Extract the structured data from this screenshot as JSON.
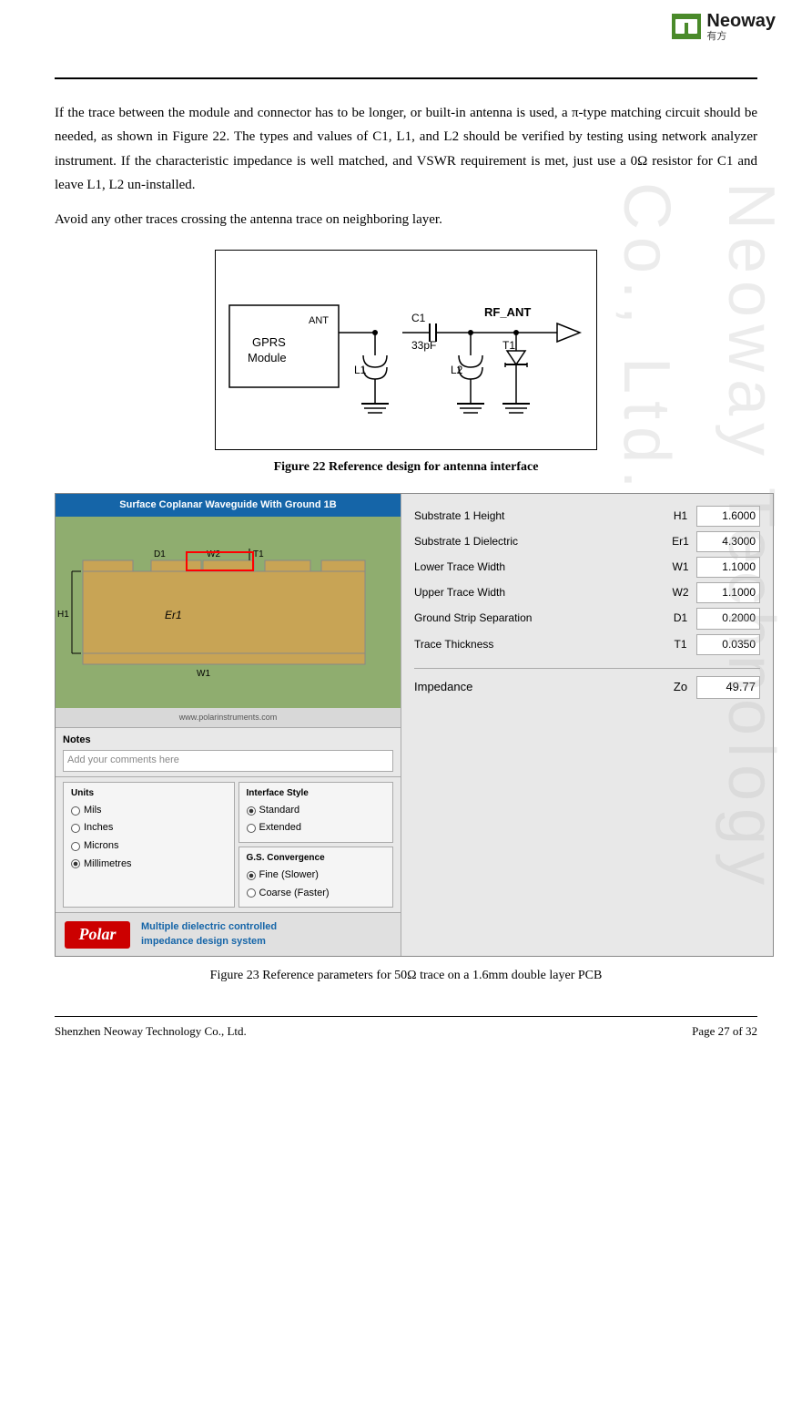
{
  "header": {
    "logo_alt": "Neoway Logo",
    "company_name": "Neoway",
    "chinese_name": "有方"
  },
  "body": {
    "paragraph1": "If the trace between the module and connector has to be longer, or built-in antenna is used, a π-type matching circuit should be needed, as shown in Figure 22. The types and values of C1, L1, and L2 should be verified by testing using network analyzer instrument. If the characteristic impedance is well matched, and VSWR requirement is met, just use a 0Ω resistor for C1 and leave L1, L2 un-installed.",
    "paragraph2": "Avoid any other traces crossing the antenna trace on neighboring layer."
  },
  "figure22": {
    "caption": "Figure 22 Reference design for antenna interface",
    "labels": {
      "ant": "ANT",
      "gprs": "GPRS",
      "module": "Module",
      "c1": "C1",
      "cap": "33pF",
      "l1": "L1",
      "l2": "L2",
      "t1": "T1",
      "rf_ant": "RF_ANT"
    }
  },
  "polar_screenshot": {
    "diagram_title": "Surface Coplanar Waveguide With Ground 1B",
    "url": "www.polarinstruments.com",
    "labels": {
      "w2": "W2",
      "d1": "D1",
      "t1": "T1",
      "h1": "H1",
      "er1": "Er1",
      "w1": "W1"
    },
    "params": [
      {
        "label": "Substrate 1 Height",
        "symbol": "H1",
        "value": "1.6000"
      },
      {
        "label": "Substrate 1 Dielectric",
        "symbol": "Er1",
        "value": "4.3000"
      },
      {
        "label": "Lower Trace Width",
        "symbol": "W1",
        "value": "1.1000"
      },
      {
        "label": "Upper Trace Width",
        "symbol": "W2",
        "value": "1.1000"
      },
      {
        "label": "Ground Strip Separation",
        "symbol": "D1",
        "value": "0.2000"
      },
      {
        "label": "Trace Thickness",
        "symbol": "T1",
        "value": "0.0350"
      }
    ],
    "impedance": {
      "label": "Impedance",
      "symbol": "Zo",
      "value": "49.77"
    },
    "notes": {
      "label": "Notes",
      "placeholder": "Add your comments here"
    },
    "units": {
      "title": "Units",
      "options": [
        "Mils",
        "Inches",
        "Microns",
        "Millimetres"
      ],
      "selected": "Millimetres"
    },
    "interface_style": {
      "title": "Interface Style",
      "options": [
        "Standard",
        "Extended"
      ],
      "selected": "Standard"
    },
    "gs_convergence": {
      "title": "G.S. Convergence",
      "options": [
        "Fine (Slower)",
        "Coarse (Faster)"
      ],
      "selected": "Fine (Slower)"
    },
    "footer_logo": "Polar",
    "footer_text_line1": "Multiple dielectric controlled",
    "footer_text_line2": "impedance design system"
  },
  "figure23": {
    "caption": "Figure 23 Reference parameters for 50Ω trace on a 1.6mm double layer PCB"
  },
  "footer": {
    "company": "Shenzhen Neoway Technology Co., Ltd.",
    "page": "Page 27 of 32"
  }
}
